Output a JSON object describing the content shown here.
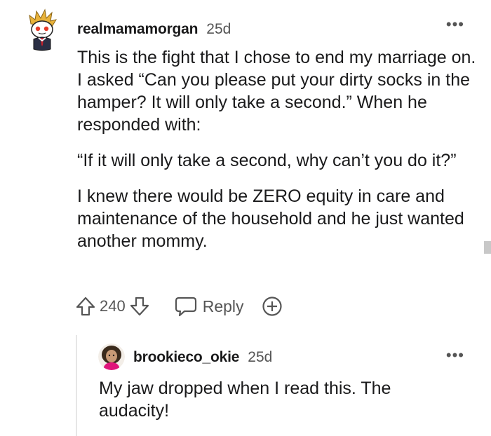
{
  "comment": {
    "username": "realmamamorgan",
    "age": "25d",
    "more": "•••",
    "paragraphs": [
      "This is the fight that I chose to end my marriage on. I asked “Can you please put your dirty socks in the hamper? It will only take a second.” When he responded with:",
      "“If it will only take a second, why can’t you do it?”",
      "I knew there would be ZERO equity in care and maintenance of the household and he just wanted another mommy."
    ],
    "score": "240",
    "reply_label": "Reply",
    "icons": {
      "upvote": "upvote-arrow-icon",
      "downvote": "downvote-arrow-icon",
      "reply": "speech-bubble-icon",
      "award": "plus-circle-icon"
    }
  },
  "reply": {
    "username": "brookieco_okie",
    "age": "25d",
    "more": "•••",
    "text": "My jaw dropped when I read this. The audacity!"
  },
  "colors": {
    "text": "#1a1a1b",
    "muted": "#555555",
    "thread_line": "#e6e6e6",
    "avatar_accent": "#e0147a"
  }
}
